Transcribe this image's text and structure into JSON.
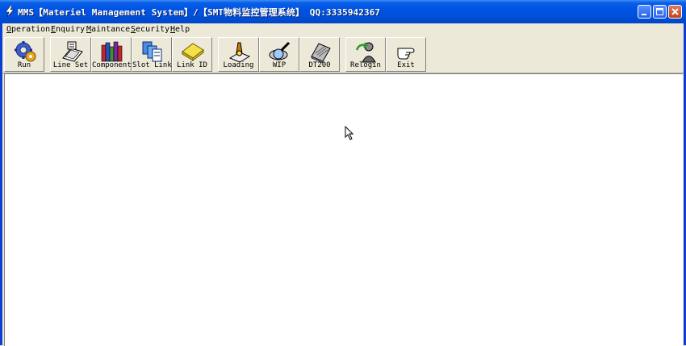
{
  "window": {
    "title": "MMS【Materiel Management System】/【SMT物料监控管理系统】 QQ:3335942367",
    "icon": "lightning-logo-icon",
    "controls": [
      "minimize-icon",
      "maximize-icon",
      "close-icon"
    ]
  },
  "menu": [
    {
      "label": "Operation"
    },
    {
      "label": "Enquiry"
    },
    {
      "label": "Maintance"
    },
    {
      "label": "Security"
    },
    {
      "label": "Help"
    }
  ],
  "toolbar": [
    {
      "label": "Run",
      "icon": "run-gears-icon"
    },
    {
      "label": "Line Set",
      "icon": "line-set-icon"
    },
    {
      "label": "Component",
      "icon": "component-books-icon"
    },
    {
      "label": "Slot Link",
      "icon": "slot-link-icon"
    },
    {
      "label": "Link ID",
      "icon": "link-id-note-icon"
    },
    {
      "label": "Loading",
      "icon": "loading-icon"
    },
    {
      "label": "WIP",
      "icon": "wip-magnifier-icon"
    },
    {
      "label": "DT200",
      "icon": "dt200-device-icon"
    },
    {
      "label": "Relogin",
      "icon": "relogin-icon"
    },
    {
      "label": "Exit",
      "icon": "exit-hand-icon"
    }
  ],
  "colors": {
    "titlebar": "#0054e3",
    "window_bg": "#ece9d8",
    "client_bg": "#ffffff"
  }
}
